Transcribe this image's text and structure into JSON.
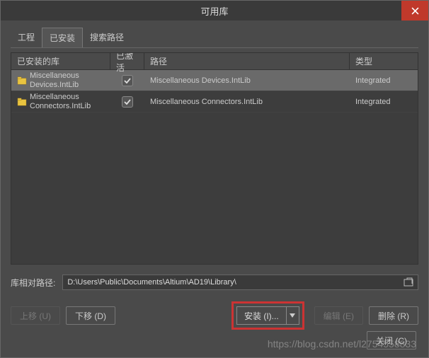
{
  "title": "可用库",
  "tabs": [
    "工程",
    "已安装",
    "搜索路径"
  ],
  "active_tab": 1,
  "headers": {
    "name": "已安装的库",
    "active": "已激活",
    "path": "路径",
    "type": "类型"
  },
  "rows": [
    {
      "name": "Miscellaneous Devices.IntLib",
      "active": true,
      "path": "Miscellaneous Devices.IntLib",
      "type": "Integrated",
      "selected": true
    },
    {
      "name": "Miscellaneous Connectors.IntLib",
      "active": true,
      "path": "Miscellaneous Connectors.IntLib",
      "type": "Integrated",
      "selected": false
    }
  ],
  "path_label": "库相对路径:",
  "path_value": "D:\\Users\\Public\\Documents\\Altium\\AD19\\Library\\",
  "buttons": {
    "move_up": "上移 (U)",
    "move_down": "下移 (D)",
    "install": "安装 (I)...",
    "edit": "编辑 (E)",
    "delete": "删除 (R)",
    "close": "关闭 (C)"
  },
  "watermark": "https://blog.csdn.net/l2754558833"
}
